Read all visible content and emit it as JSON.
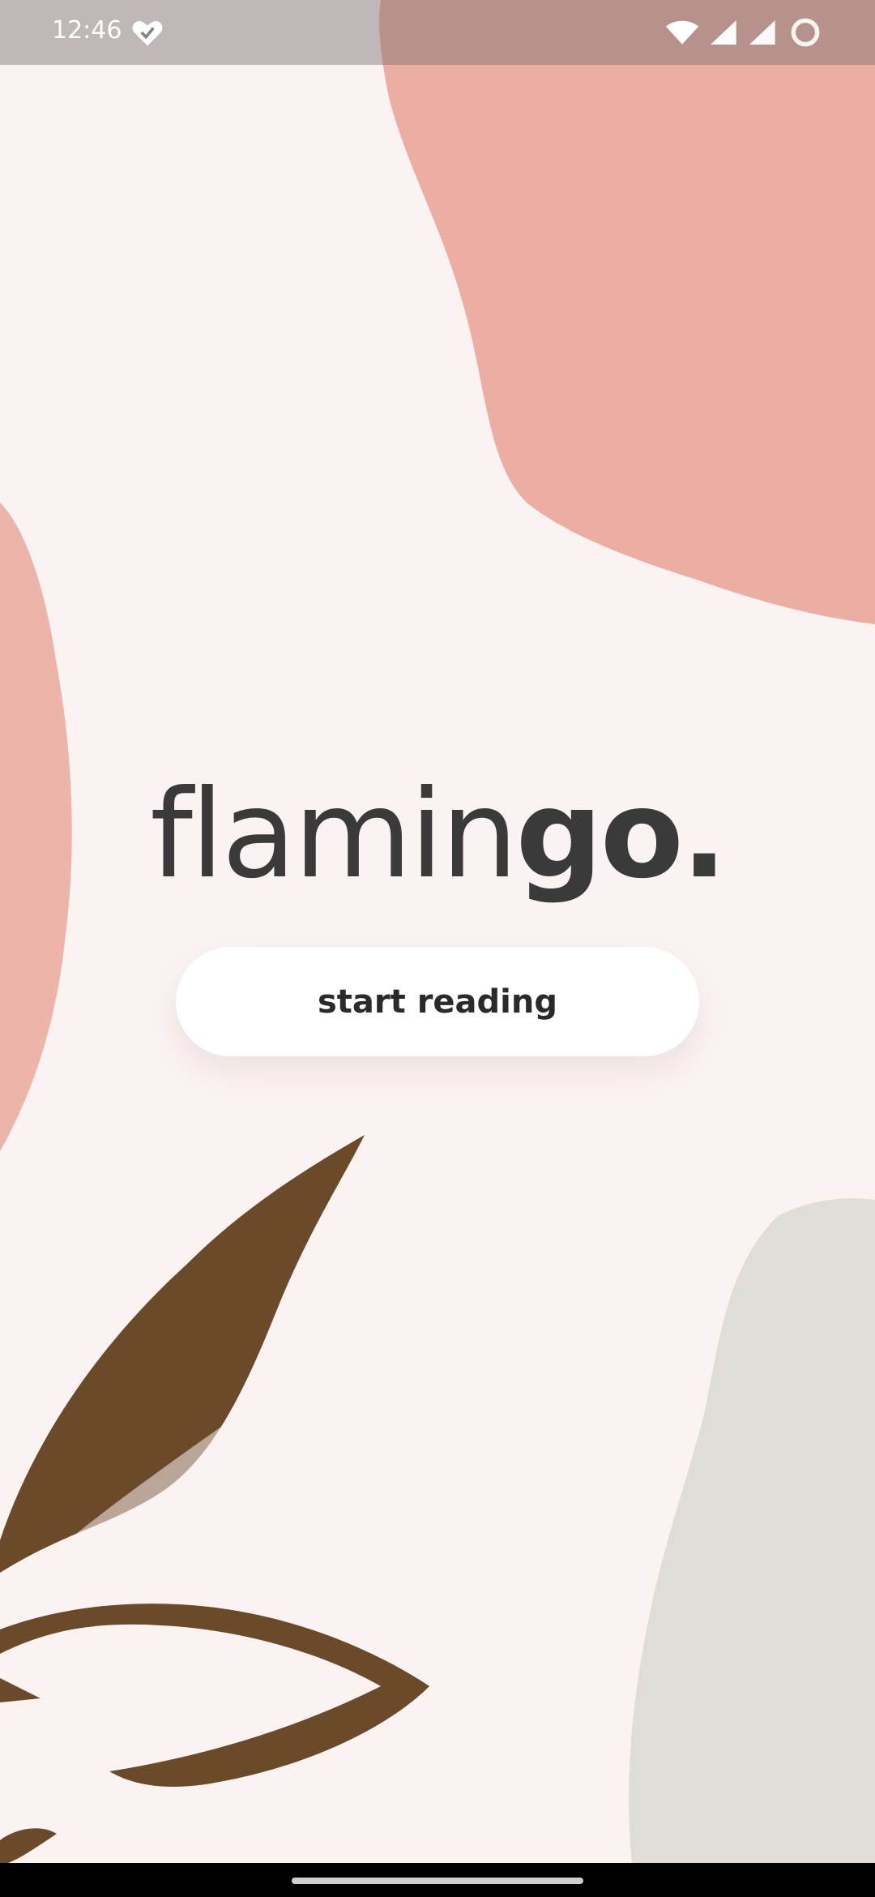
{
  "status_bar": {
    "time": "12:46",
    "icons": [
      "heart-icon",
      "wifi-icon",
      "signal-icon",
      "signal-icon",
      "loading-icon"
    ]
  },
  "brand": {
    "name_light": "flamin",
    "name_bold": "go."
  },
  "actions": {
    "start_label": "start reading"
  },
  "colors": {
    "background": "#fbf3f2",
    "blob_pink": "#e9a79b",
    "blob_gray": "#dcdad6",
    "leaf_brown": "#6b4a2a",
    "text": "#3a3a3a",
    "button_bg": "#ffffff"
  }
}
